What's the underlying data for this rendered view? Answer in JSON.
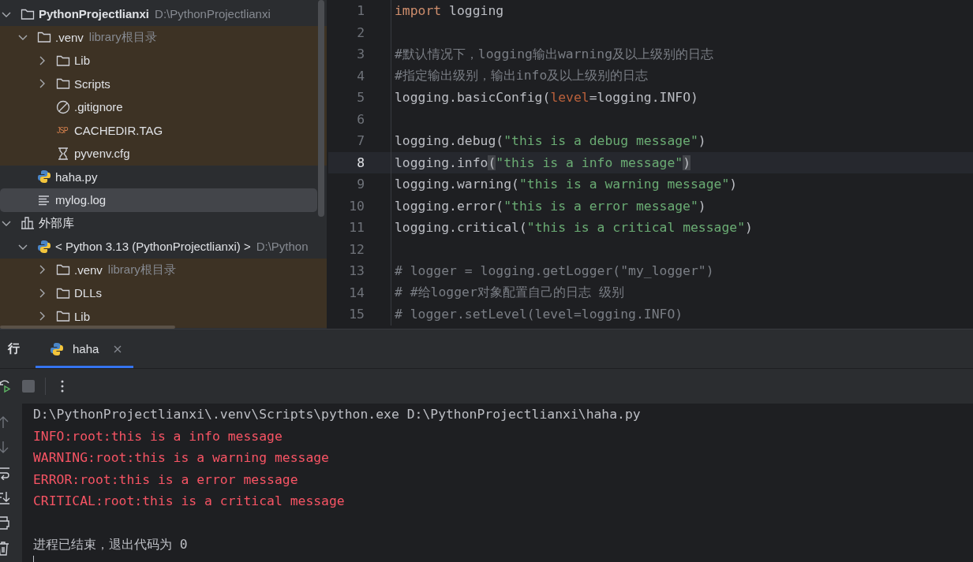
{
  "project_tree": {
    "items": [
      {
        "kind": "folder",
        "label": "PythonProjectlianxi",
        "hint": "D:\\PythonProjectlianxi",
        "bold": true,
        "expanded": true,
        "excluded": false,
        "selected": false,
        "children": [
          {
            "kind": "folder",
            "label": ".venv",
            "hint": "library根目录",
            "expanded": true,
            "excluded": true,
            "selected": false,
            "children": [
              {
                "kind": "folder",
                "label": "Lib",
                "expanded": false,
                "excluded": true,
                "selected": false
              },
              {
                "kind": "folder",
                "label": "Scripts",
                "expanded": false,
                "excluded": true,
                "selected": false
              },
              {
                "kind": "ignore",
                "label": ".gitignore",
                "excluded": true,
                "selected": false
              },
              {
                "kind": "typed",
                "badge": "JSP",
                "label": "CACHEDIR.TAG",
                "excluded": true,
                "selected": false
              },
              {
                "kind": "config",
                "label": "pyvenv.cfg",
                "excluded": true,
                "selected": false
              }
            ]
          },
          {
            "kind": "python",
            "label": "haha.py",
            "excluded": false,
            "selected": false
          },
          {
            "kind": "log",
            "label": "mylog.log",
            "excluded": false,
            "selected": true
          }
        ]
      },
      {
        "kind": "library",
        "label": "外部库",
        "expanded": true,
        "excluded": false,
        "selected": false,
        "children": [
          {
            "kind": "python",
            "label": "< Python 3.13 (PythonProjectlianxi) >",
            "hint": "D:\\Python",
            "expanded": true,
            "excluded": false,
            "selected": false,
            "children": [
              {
                "kind": "folder",
                "label": ".venv",
                "hint": "library根目录",
                "expanded": false,
                "excluded": true,
                "selected": false
              },
              {
                "kind": "folder",
                "label": "DLLs",
                "expanded": false,
                "excluded": true,
                "selected": false
              },
              {
                "kind": "folder",
                "label": "Lib",
                "expanded": false,
                "excluded": true,
                "selected": false
              }
            ]
          }
        ]
      }
    ]
  },
  "editor": {
    "lines": [
      {
        "number": "1",
        "current": false,
        "tokens": [
          {
            "kind": "kw",
            "text": "import"
          },
          {
            "kind": "plain",
            "text": " logging"
          }
        ]
      },
      {
        "number": "2",
        "current": false
      },
      {
        "number": "3",
        "current": false,
        "tokens": [
          {
            "kind": "comment",
            "text": "#默认情况下，logging输出warning及以上级别的日志"
          }
        ]
      },
      {
        "number": "4",
        "current": false,
        "tokens": [
          {
            "kind": "comment",
            "text": "#指定输出级别，输出info及以上级别的日志"
          }
        ]
      },
      {
        "number": "5",
        "current": false,
        "tokens": [
          {
            "kind": "plain",
            "text": "logging.basicConfig("
          },
          {
            "kind": "param",
            "text": "level"
          },
          {
            "kind": "plain",
            "text": "=logging.INFO)"
          }
        ]
      },
      {
        "number": "6",
        "current": false
      },
      {
        "number": "7",
        "current": false,
        "tokens": [
          {
            "kind": "plain",
            "text": "logging.debug("
          },
          {
            "kind": "str",
            "text": "\"this is a debug message\""
          },
          {
            "kind": "plain",
            "text": ")"
          }
        ]
      },
      {
        "number": "8",
        "current": true,
        "tokens": [
          {
            "kind": "plain",
            "text": "logging.info"
          },
          {
            "kind": "match",
            "text": "("
          },
          {
            "kind": "str",
            "text": "\"this is a info message\""
          },
          {
            "kind": "match",
            "text": ")"
          }
        ]
      },
      {
        "number": "9",
        "current": false,
        "tokens": [
          {
            "kind": "plain",
            "text": "logging.warning("
          },
          {
            "kind": "str",
            "text": "\"this is a warning message\""
          },
          {
            "kind": "plain",
            "text": ")"
          }
        ]
      },
      {
        "number": "10",
        "current": false,
        "tokens": [
          {
            "kind": "plain",
            "text": "logging.error("
          },
          {
            "kind": "str",
            "text": "\"this is a error message\""
          },
          {
            "kind": "plain",
            "text": ")"
          }
        ]
      },
      {
        "number": "11",
        "current": false,
        "tokens": [
          {
            "kind": "plain",
            "text": "logging.critical("
          },
          {
            "kind": "str",
            "text": "\"this is a critical message\""
          },
          {
            "kind": "plain",
            "text": ")"
          }
        ]
      },
      {
        "number": "12",
        "current": false
      },
      {
        "number": "13",
        "current": false,
        "tokens": [
          {
            "kind": "comment",
            "text": "# logger = logging.getLogger(\"my_logger\")"
          }
        ]
      },
      {
        "number": "14",
        "current": false,
        "tokens": [
          {
            "kind": "comment",
            "text": "# #给logger对象配置自己的日志 级别"
          }
        ]
      },
      {
        "number": "15",
        "current": false,
        "tokens": [
          {
            "kind": "comment",
            "text": "# logger.setLevel(level=logging.INFO)"
          }
        ]
      }
    ]
  },
  "run_panel": {
    "title": "行",
    "tabs": [
      {
        "label": "haha",
        "selected": true
      }
    ],
    "console": [
      {
        "kind": "stdout",
        "text": "D:\\PythonProjectlianxi\\.venv\\Scripts\\python.exe D:\\PythonProjectlianxi\\haha.py"
      },
      {
        "kind": "stderr",
        "text": "INFO:root:this is a info message"
      },
      {
        "kind": "stderr",
        "text": "WARNING:root:this is a warning message"
      },
      {
        "kind": "stderr",
        "text": "ERROR:root:this is a error message"
      },
      {
        "kind": "stderr",
        "text": "CRITICAL:root:this is a critical message"
      },
      {
        "kind": "blank"
      },
      {
        "kind": "stdout",
        "text": "进程已结束，退出代码为 0"
      }
    ]
  }
}
